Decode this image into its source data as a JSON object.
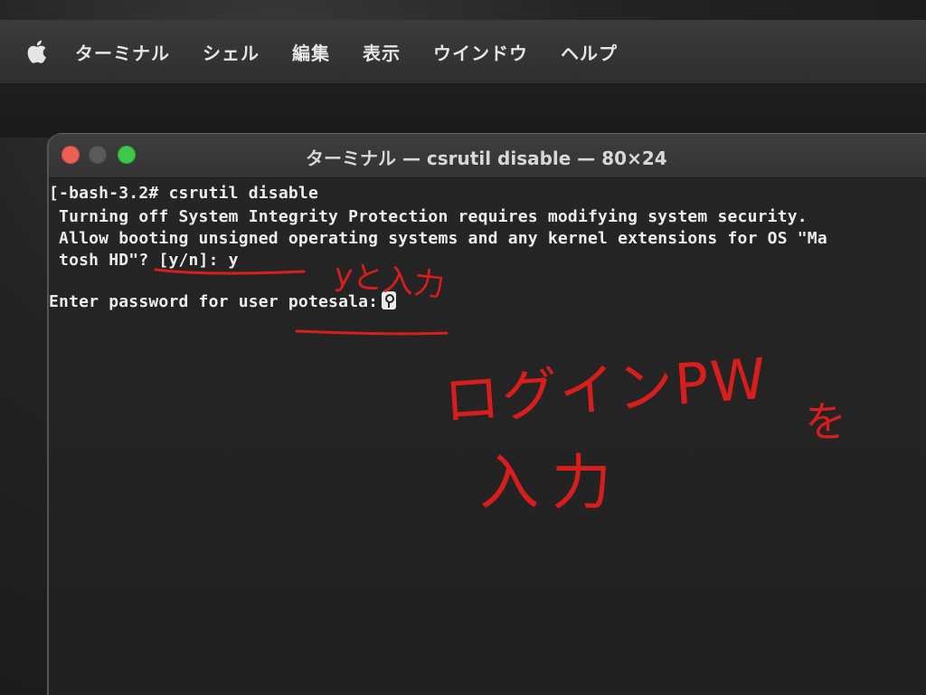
{
  "menubar": {
    "apple_icon": "apple-logo",
    "items": [
      "ターミナル",
      "シェル",
      "編集",
      "表示",
      "ウインドウ",
      "ヘルプ"
    ]
  },
  "window": {
    "title": "ターミナル — csrutil disable — 80×24",
    "traffic_lights": [
      "close",
      "minimize",
      "zoom"
    ]
  },
  "terminal": {
    "lines": [
      "[-bash-3.2# csrutil disable",
      " Turning off System Integrity Protection requires modifying system security.",
      " Allow booting unsigned operating systems and any kernel extensions for OS \"Ma",
      " tosh HD\"? [y/n]: y",
      "",
      "Enter password for user potesala:"
    ],
    "cursor_icon": "key-icon"
  },
  "annotations": {
    "y_note": "yと入力",
    "login_pw": "ログインPW",
    "wo": "を",
    "nyuryoku": "入力",
    "color": "#d81d1d"
  }
}
